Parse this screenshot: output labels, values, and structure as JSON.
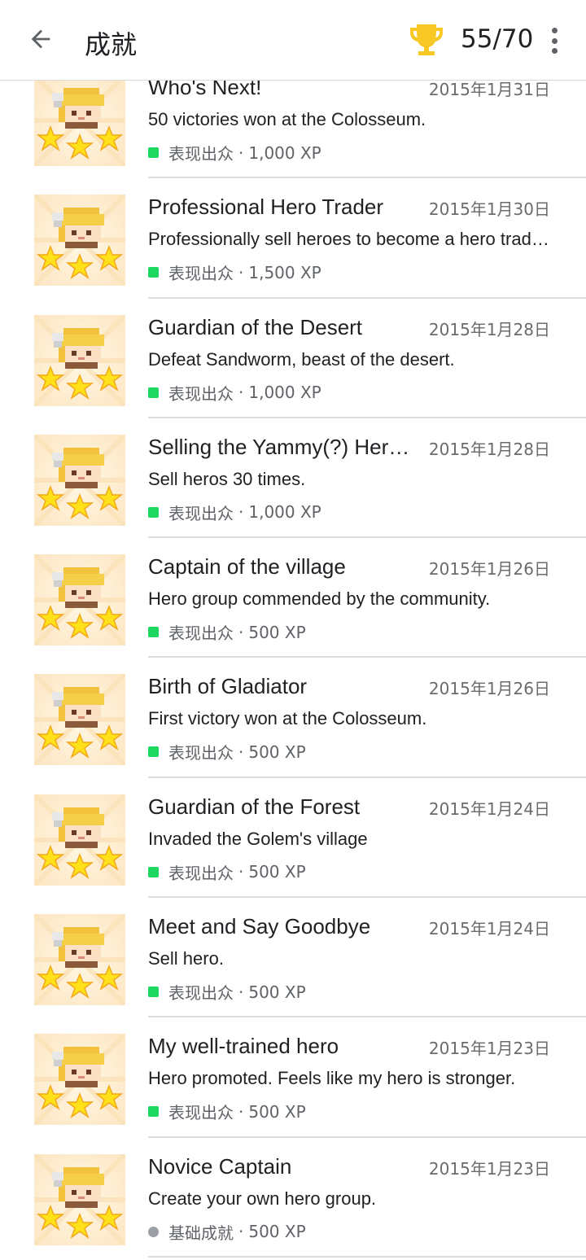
{
  "header": {
    "title": "成就",
    "progress": "55/70",
    "trophy_color": "#f7c824"
  },
  "colors": {
    "outstanding": "#1ed760",
    "basic": "#9aa0a6"
  },
  "achievements": [
    {
      "name": "Who's Next!",
      "date": "2015年1月31日",
      "desc": "50 victories won at the Colosseum.",
      "category": "表现出众",
      "xp": "1,000 XP",
      "type": "outstanding"
    },
    {
      "name": "Professional Hero Trader",
      "date": "2015年1月30日",
      "desc": "Professionally sell heroes to become a hero trader.",
      "category": "表现出众",
      "xp": "1,500 XP",
      "type": "outstanding"
    },
    {
      "name": "Guardian of the Desert",
      "date": "2015年1月28日",
      "desc": "Defeat Sandworm, beast of the desert.",
      "category": "表现出众",
      "xp": "1,000 XP",
      "type": "outstanding"
    },
    {
      "name": "Selling the Yammy(?) Heroes",
      "date": "2015年1月28日",
      "desc": "Sell heros 30 times.",
      "category": "表现出众",
      "xp": "1,000 XP",
      "type": "outstanding"
    },
    {
      "name": "Captain of the village",
      "date": "2015年1月26日",
      "desc": "Hero group commended by the community.",
      "category": "表现出众",
      "xp": "500 XP",
      "type": "outstanding"
    },
    {
      "name": "Birth of Gladiator",
      "date": "2015年1月26日",
      "desc": "First victory won at the Colosseum.",
      "category": "表现出众",
      "xp": "500 XP",
      "type": "outstanding"
    },
    {
      "name": "Guardian of the Forest",
      "date": "2015年1月24日",
      "desc": "Invaded the Golem's village",
      "category": "表现出众",
      "xp": "500 XP",
      "type": "outstanding"
    },
    {
      "name": "Meet and Say Goodbye",
      "date": "2015年1月24日",
      "desc": "Sell hero.",
      "category": "表现出众",
      "xp": "500 XP",
      "type": "outstanding"
    },
    {
      "name": "My well-trained hero",
      "date": "2015年1月23日",
      "desc": "Hero promoted. Feels like my hero is stronger.",
      "category": "表现出众",
      "xp": "500 XP",
      "type": "outstanding"
    },
    {
      "name": "Novice Captain",
      "date": "2015年1月23日",
      "desc": "Create your own hero group.",
      "category": "基础成就",
      "xp": "500 XP",
      "type": "basic"
    }
  ]
}
